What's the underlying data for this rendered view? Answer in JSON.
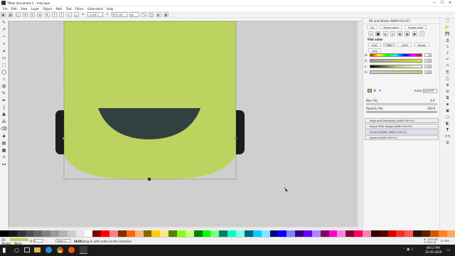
{
  "window": {
    "title": "*New document 1 - Inkscape",
    "min": "—",
    "max": "☐",
    "close": "✕"
  },
  "menu": [
    "File",
    "Edit",
    "View",
    "Layer",
    "Object",
    "Path",
    "Text",
    "Filters",
    "Extensions",
    "Help"
  ],
  "toolctrl": {
    "x_label": "X:",
    "x_value": "-1414.2",
    "y_label": "Y:",
    "y_value": "679.167",
    "unit": "px"
  },
  "tools": [
    "selector",
    "node",
    "tweak",
    "zoom",
    "measure",
    "rect",
    "3dbox",
    "ellipse",
    "star",
    "spiral",
    "pencil",
    "pen",
    "calligraphy",
    "text",
    "spray",
    "eraser",
    "bucket",
    "gradient",
    "mesh",
    "dropper",
    "connector"
  ],
  "panel": {
    "title": "Fill and Stroke (Shift+Ctrl+F)",
    "tabs": [
      "Fill",
      "Stroke paint",
      "Stroke style"
    ],
    "flat_color": "Flat color",
    "modes": [
      "RGB",
      "HSL",
      "CMYK",
      "Wheel",
      "CMS"
    ],
    "active_mode": "HSL",
    "channels": [
      {
        "label": "H:",
        "value": "51"
      },
      {
        "label": "S:",
        "value": "143"
      },
      {
        "label": "L:",
        "value": "153"
      },
      {
        "label": "A:",
        "value": "255"
      }
    ],
    "rgba_label": "RGBA:",
    "rgba_value": "bcd35fff",
    "blur_label": "Blur (%)",
    "blur_value": "0.0",
    "opacity_label": "Opacity (%)",
    "opacity_value": "100.0",
    "docked": [
      "Align and Distribute (Shift+Ctrl+A)",
      "Export PNG Image (Shift+Ctrl+E)",
      "Fill and Stroke (Shift+Ctrl+F)",
      "Layers (Shift+Ctrl+L)"
    ]
  },
  "status": {
    "fill_label": "Fill:",
    "stroke_label": "Stroke:",
    "stroke_value": "None",
    "opacity_label": "O:",
    "opacity_value": "0",
    "layer": "Layer 1",
    "message_bold": "Shift:",
    "message": "drag to add nodes to the selection",
    "x": "X: -1471.63",
    "y": "Y: 1021.31",
    "zoom": "Z: 35%"
  },
  "taskbar": {
    "time": "09:17 PM",
    "date": "25-05-2019"
  },
  "colors": {
    "shape_green": "#bcd35f",
    "mouth": "#334040",
    "ears": "#1c1c1c",
    "canvas": "#cfcfcf"
  }
}
